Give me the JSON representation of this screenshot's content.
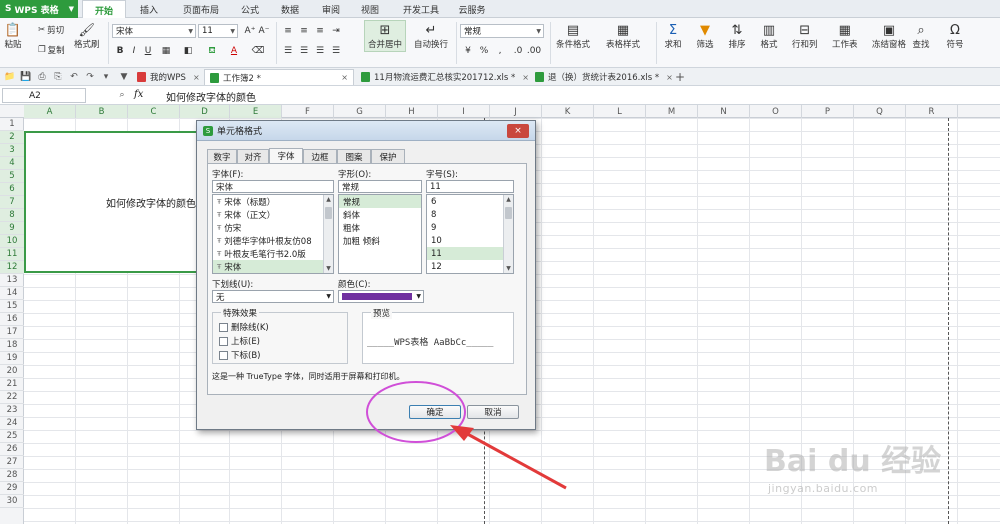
{
  "app": {
    "name": "WPS 表格"
  },
  "ribbon_tabs": [
    "开始",
    "插入",
    "页面布局",
    "公式",
    "数据",
    "审阅",
    "视图",
    "开发工具",
    "云服务"
  ],
  "ribbon": {
    "paste": "粘贴",
    "cut": "剪切",
    "copy": "复制",
    "format_painter": "格式刷",
    "font_name": "宋体",
    "font_size": "11",
    "merge_center": "合并居中",
    "wrap_text": "自动换行",
    "number_format": "常规",
    "cond_format": "条件格式",
    "table_style": "表格样式",
    "sum": "求和",
    "filter": "筛选",
    "sort": "排序",
    "format": "格式",
    "row_col": "行和列",
    "worksheet": "工作表",
    "freeze": "冻结窗格",
    "find": "查找",
    "symbol": "符号"
  },
  "doc_tabs": [
    {
      "label": "我的WPS",
      "close": "×"
    },
    {
      "label": "工作簿2 *",
      "close": "×"
    },
    {
      "label": "11月物流运费汇总核实201712.xls *",
      "close": "×"
    },
    {
      "label": "退（换）货统计表2016.xls *",
      "close": "×"
    }
  ],
  "new_tab": "+",
  "formula_bar": {
    "name_box": "A2",
    "fx": "fx",
    "content": "如何修改字体的颜色"
  },
  "columns": [
    "A",
    "B",
    "C",
    "D",
    "E",
    "F",
    "G",
    "H",
    "I",
    "J",
    "K",
    "L",
    "M",
    "N",
    "O",
    "P",
    "Q",
    "R"
  ],
  "rows": [
    "1",
    "2",
    "3",
    "4",
    "5",
    "6",
    "7",
    "8",
    "9",
    "10",
    "11",
    "12",
    "13",
    "14",
    "15",
    "16",
    "17",
    "18",
    "19",
    "20",
    "21",
    "22",
    "23",
    "24",
    "25",
    "26",
    "27",
    "28",
    "29",
    "30"
  ],
  "cell_text": "如何修改字体的颜色",
  "dialog": {
    "title": "单元格格式",
    "close": "×",
    "tabs": [
      "数字",
      "对齐",
      "字体",
      "边框",
      "图案",
      "保护"
    ],
    "font_label": "字体(F):",
    "font_value": "宋体",
    "font_list": [
      "宋体（标题）",
      "宋体（正文）",
      "仿宋",
      "刘德华字体叶根友仿08",
      "叶根友毛笔行书2.0版",
      "宋体"
    ],
    "style_label": "字形(O):",
    "style_value": "常规",
    "style_list": [
      "常规",
      "斜体",
      "粗体",
      "加粗 倾斜"
    ],
    "size_label": "字号(S):",
    "size_value": "11",
    "size_list": [
      "6",
      "8",
      "9",
      "10",
      "11",
      "12"
    ],
    "underline_label": "下划线(U):",
    "underline_value": "无",
    "color_label": "颜色(C):",
    "color_value": "#7030a0",
    "effects_label": "特殊效果",
    "strikethrough": "删除线(K)",
    "superscript": "上标(E)",
    "subscript": "下标(B)",
    "preview_label": "预览",
    "preview_text": "_____WPS表格  AaBbCc_____",
    "note": "这是一种 TrueType 字体，同时适用于屏幕和打印机。",
    "ok": "确定",
    "cancel": "取消"
  },
  "watermark": {
    "main": "Bai du 经验",
    "sub": "jingyan.baidu.com"
  },
  "colors": {
    "brand_green": "#2e9b3d",
    "highlight": "#d04fd8",
    "arrow": "#e23a3a"
  }
}
